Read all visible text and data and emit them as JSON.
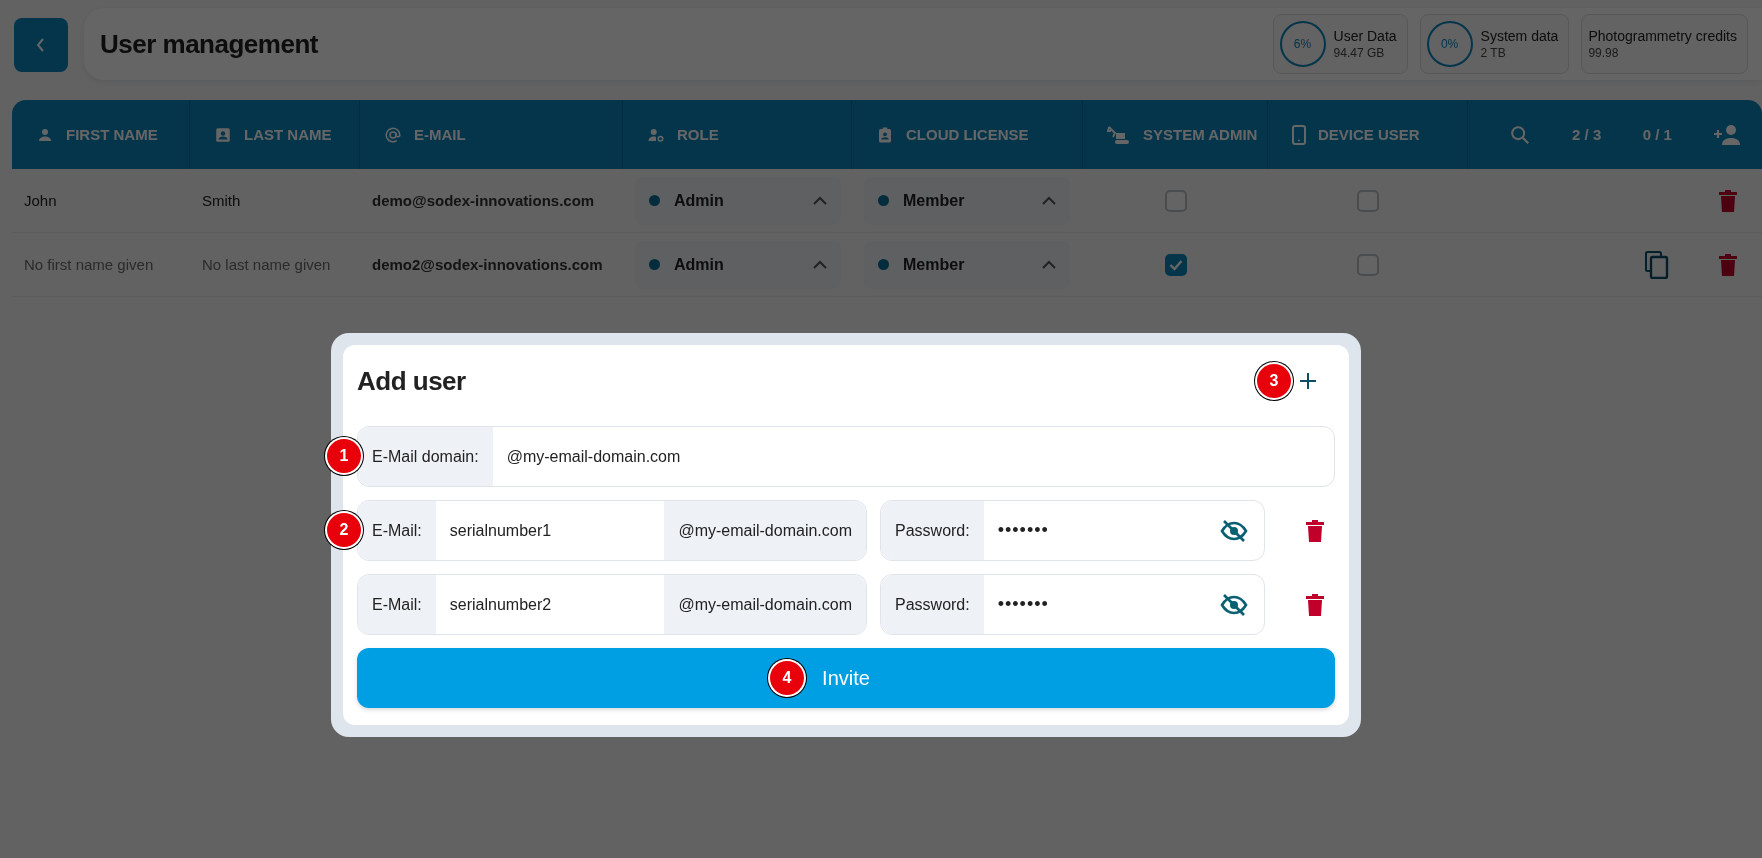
{
  "header": {
    "title": "User management",
    "stats": [
      {
        "kind": "ring",
        "reading": "6%",
        "label": "User Data",
        "value": "94.47 GB"
      },
      {
        "kind": "ring",
        "reading": "0%",
        "label": "System data",
        "value": "2 TB"
      },
      {
        "kind": "plain",
        "label": "Photogrammetry credits",
        "value": "99.98"
      }
    ]
  },
  "table": {
    "columns": [
      "FIRST NAME",
      "LAST NAME",
      "E-MAIL",
      "ROLE",
      "CLOUD LICENSE",
      "SYSTEM ADMIN",
      "DEVICE USER"
    ],
    "pager": "2 / 3",
    "count": "0 / 1",
    "rows": [
      {
        "first_name": {
          "text": "John",
          "missing": false
        },
        "last_name": {
          "text": "Smith",
          "missing": false
        },
        "email": "demo@sodex-innovations.com",
        "role": "Admin",
        "license": "Member",
        "system_admin": false,
        "device_user": false,
        "copy": false
      },
      {
        "first_name": {
          "text": "No first name given",
          "missing": true
        },
        "last_name": {
          "text": "No last name given",
          "missing": true
        },
        "email": "demo2@sodex-innovations.com",
        "role": "Admin",
        "license": "Member",
        "system_admin": true,
        "device_user": false,
        "copy": true
      }
    ]
  },
  "dialog": {
    "title": "Add user",
    "add_callout": "3",
    "domain": {
      "label": "E-Mail domain:",
      "value": "@my-email-domain.com",
      "callout": "1"
    },
    "entries": [
      {
        "email_label": "E-Mail:",
        "email_value": "serialnumber1",
        "suffix": "@my-email-domain.com",
        "password_label": "Password:",
        "password_value": "•••••••",
        "callout": "2"
      },
      {
        "email_label": "E-Mail:",
        "email_value": "serialnumber2",
        "suffix": "@my-email-domain.com",
        "password_label": "Password:",
        "password_value": "•••••••"
      }
    ],
    "invite": {
      "label": "Invite",
      "callout": "4"
    }
  }
}
